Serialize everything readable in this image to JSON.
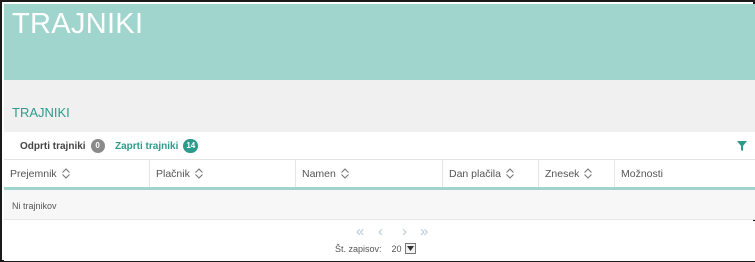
{
  "header": {
    "title": "TRAJNIKI"
  },
  "section": {
    "title": "TRAJNIKI"
  },
  "tabs": [
    {
      "label": "Odprti trajniki",
      "count": "0"
    },
    {
      "label": "Zaprti trajniki",
      "count": "14"
    }
  ],
  "columns": [
    "Prejemnik",
    "Plačnik",
    "Namen",
    "Dan plačila",
    "Znesek",
    "Možnosti"
  ],
  "table": {
    "empty_message": "Ni trajnikov"
  },
  "pagination": {
    "first": "«",
    "prev": "‹",
    "next": "›",
    "last": "»",
    "records_label": "Št. zapisov:",
    "page_size": "20"
  },
  "colors": {
    "banner": "#9fd5cc",
    "accent": "#2e9a8c"
  }
}
